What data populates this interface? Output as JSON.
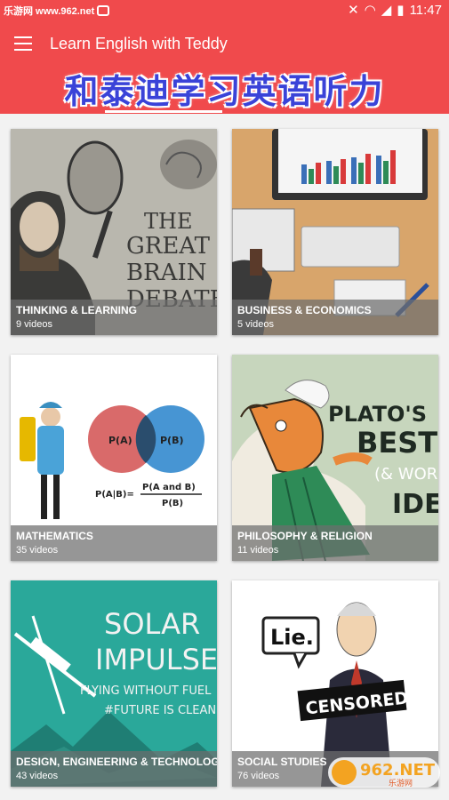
{
  "status_bar": {
    "site": "乐游网 www.962.net",
    "time": "11:47"
  },
  "app_bar": {
    "title": "Learn English with Teddy",
    "overlay": "和泰迪学习英语听力"
  },
  "categories": [
    {
      "name": "THINKING & LEARNING",
      "count": "9 videos"
    },
    {
      "name": "BUSINESS & ECONOMICS",
      "count": "5 videos"
    },
    {
      "name": "MATHEMATICS",
      "count": "35 videos"
    },
    {
      "name": "PHILOSOPHY & RELIGION",
      "count": "11 videos"
    },
    {
      "name": "DESIGN, ENGINEERING & TECHNOLOGY",
      "count": "43 videos"
    },
    {
      "name": "SOCIAL STUDIES",
      "count": "76 videos"
    }
  ],
  "art_text": {
    "debate": [
      "THE",
      "GREAT",
      "BRAIN",
      "DEBATE"
    ],
    "pa": "P(A)",
    "pb": "P(B)",
    "formula_left": "P(A|B)=",
    "formula_top": "P(A and B)",
    "formula_bottom": "P(B)",
    "plato": [
      "PLATO'S",
      "BEST",
      "(& WOR",
      "IDE"
    ],
    "solar": [
      "SOLAR",
      "IMPULSE",
      "FLYING WITHOUT FUEL",
      "#FUTURE IS CLEAN"
    ],
    "lie": "Lie.",
    "censored": "CENSORED"
  },
  "watermark": {
    "brand": "962.NET",
    "sub": "乐游网"
  }
}
